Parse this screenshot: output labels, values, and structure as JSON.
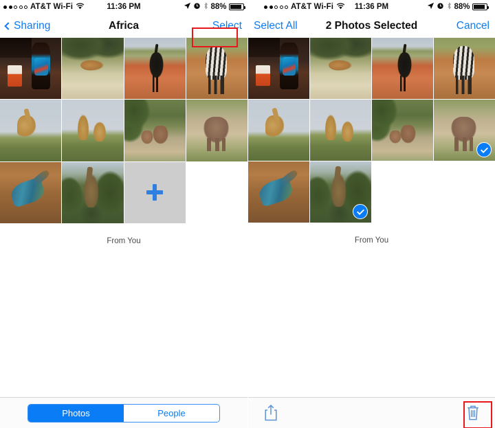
{
  "left_panel": {
    "status_bar": {
      "signal_filled": 2,
      "signal_total": 5,
      "carrier": "AT&T Wi-Fi",
      "wifi_icon": "wifi-icon",
      "time": "11:36 PM",
      "location_icon": "location-arrow-icon",
      "alarm_icon": "alarm-clock-icon",
      "bluetooth_icon": "bluetooth-icon",
      "battery_percent": "88%"
    },
    "nav_bar": {
      "back_label": "Sharing",
      "back_icon": "chevron-left-icon",
      "title": "Africa",
      "action_label": "Select",
      "action_highlighted": true
    },
    "grid": {
      "columns": 4,
      "tiles": [
        {
          "name": "photo-bar-bottle",
          "art": "art-bar",
          "selected": false
        },
        {
          "name": "photo-lion",
          "art": "art-lion",
          "selected": false
        },
        {
          "name": "photo-ostrich",
          "art": "art-ostrich",
          "selected": false
        },
        {
          "name": "photo-zebra-foal",
          "art": "art-zebra",
          "selected": false
        },
        {
          "name": "photo-giraffe",
          "art": "art-giraffe1",
          "selected": false
        },
        {
          "name": "photo-two-giraffes",
          "art": "art-giraffe2",
          "selected": false
        },
        {
          "name": "photo-elephants-walking",
          "art": "art-eleph1",
          "selected": false
        },
        {
          "name": "photo-elephant",
          "art": "art-eleph2",
          "selected": false
        },
        {
          "name": "photo-lizard",
          "art": "art-lizard",
          "selected": false
        },
        {
          "name": "photo-giraffe-trees",
          "art": "art-giraffetree",
          "selected": false
        }
      ],
      "add_tile": {
        "name": "add-photos-tile",
        "icon": "plus-icon"
      }
    },
    "caption": "From You",
    "toolbar": {
      "type": "segmented",
      "segments": [
        {
          "label": "Photos",
          "selected": true
        },
        {
          "label": "People",
          "selected": false
        }
      ]
    }
  },
  "right_panel": {
    "status_bar": {
      "signal_filled": 2,
      "signal_total": 5,
      "carrier": "AT&T Wi-Fi",
      "wifi_icon": "wifi-icon",
      "time": "11:36 PM",
      "location_icon": "location-arrow-icon",
      "alarm_icon": "alarm-clock-icon",
      "bluetooth_icon": "bluetooth-icon",
      "battery_percent": "88%"
    },
    "nav_bar": {
      "left_label": "Select All",
      "title": "2 Photos Selected",
      "right_label": "Cancel"
    },
    "grid": {
      "columns": 4,
      "tiles": [
        {
          "name": "photo-bar-bottle",
          "art": "art-bar",
          "selected": false
        },
        {
          "name": "photo-lion",
          "art": "art-lion",
          "selected": false
        },
        {
          "name": "photo-ostrich",
          "art": "art-ostrich",
          "selected": false
        },
        {
          "name": "photo-zebra-foal",
          "art": "art-zebra",
          "selected": false
        },
        {
          "name": "photo-giraffe",
          "art": "art-giraffe1",
          "selected": false
        },
        {
          "name": "photo-two-giraffes",
          "art": "art-giraffe2",
          "selected": false
        },
        {
          "name": "photo-elephants-walking",
          "art": "art-eleph1",
          "selected": false
        },
        {
          "name": "photo-elephant",
          "art": "art-eleph2",
          "selected": true
        },
        {
          "name": "photo-lizard",
          "art": "art-lizard",
          "selected": false
        },
        {
          "name": "photo-giraffe-trees",
          "art": "art-giraffetree",
          "selected": true
        }
      ],
      "add_tile": null
    },
    "caption": "From You",
    "toolbar": {
      "type": "actions",
      "share_icon": "share-icon",
      "trash_icon": "trash-icon",
      "trash_highlighted": true
    }
  },
  "colors": {
    "accent_blue": "#0a7cf6",
    "annotation_red": "#e8171b",
    "add_tile_gray": "#cdcdcd",
    "caption_gray": "#4a4a4a"
  }
}
